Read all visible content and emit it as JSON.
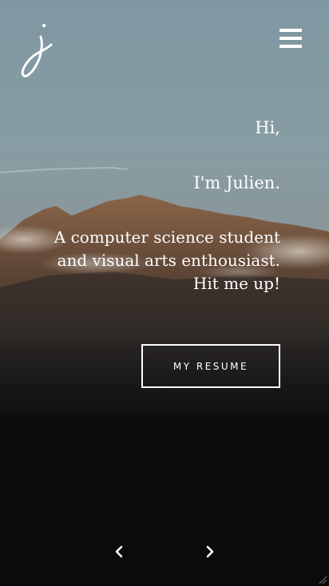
{
  "hero": {
    "greeting": "Hi,",
    "name_line": "I'm Julien.",
    "tagline_lines": [
      "A computer science student",
      "and visual arts enthousiast.",
      "Hit me up!"
    ]
  },
  "cta": {
    "resume_label": "MY RESUME"
  },
  "icons": {
    "logo": "j-monogram-logo",
    "menu": "hamburger-menu-icon",
    "prev": "chevron-left-icon",
    "next": "chevron-right-icon"
  },
  "colors": {
    "text": "#ffffff",
    "sky": "#7f97a1",
    "night": "#0b0b0e",
    "mountain": "#7d5a43"
  }
}
